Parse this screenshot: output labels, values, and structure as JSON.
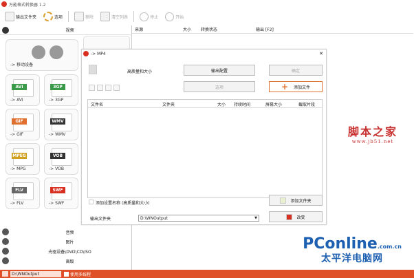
{
  "window": {
    "title": "万能格式转换器 1.2"
  },
  "toolbar": {
    "items": [
      {
        "label": "输出文件夹",
        "enabled": true
      },
      {
        "label": "选项",
        "enabled": true
      },
      {
        "label": "移除",
        "enabled": false
      },
      {
        "label": "清空列表",
        "enabled": false
      },
      {
        "label": "停止",
        "enabled": false
      },
      {
        "label": "开始",
        "enabled": false
      }
    ]
  },
  "sidebar": {
    "category_top": "视频",
    "tiles": [
      {
        "badge": "",
        "label": "-> 移动设备"
      },
      {
        "badge": "AVI",
        "label": "-> AVI",
        "color": "#3a9a48"
      },
      {
        "badge": "3GP",
        "label": "-> 3GP",
        "color": "#3a9a48"
      },
      {
        "badge": "GIF",
        "label": "-> GIF",
        "color": "#e07030"
      },
      {
        "badge": "WMV",
        "label": "-> WMV",
        "color": "#333333"
      },
      {
        "badge": "MPEG",
        "label": "-> MPG",
        "color": "#d0a020"
      },
      {
        "badge": "VOB",
        "label": "-> VOB",
        "color": "#333333"
      },
      {
        "badge": "FLV",
        "label": "-> FLV",
        "color": "#666666"
      },
      {
        "badge": "SWF",
        "label": "-> SWF",
        "color": "#d83020"
      }
    ],
    "categories_bottom": [
      "音频",
      "图片",
      "光驱设备\\DVD\\CD\\ISO",
      "高级"
    ]
  },
  "filelist": {
    "columns": [
      "来源",
      "大小",
      "转换状态",
      "输出 [F2]"
    ]
  },
  "dialog": {
    "title": "-> MP4",
    "quality_label": "高质量和大小",
    "output_config": "输出配置",
    "ok": "确定",
    "options": "选项",
    "add_file": "添加文件",
    "columns": [
      "文件名",
      "文件夹",
      "大小",
      "持续时间",
      "屏幕大小",
      "截取片段"
    ],
    "add_setting_name": "添加设置名称",
    "setting_name_value": "(高质量和大小)",
    "add_folder": "添加文件夹",
    "output_folder_label": "输出文件夹",
    "output_folder_value": "D:\\WNOutput",
    "change": "改变"
  },
  "statusbar": {
    "path": "D:\\WNOutput",
    "multithread": "使用多线程"
  },
  "watermarks": {
    "jb51_cn": "脚本之家",
    "jb51_url": "www.jb51.net",
    "pconline_brand": "PConline",
    "pconline_domain": ".com.cn",
    "pconline_cn": "太平洋电脑网"
  }
}
